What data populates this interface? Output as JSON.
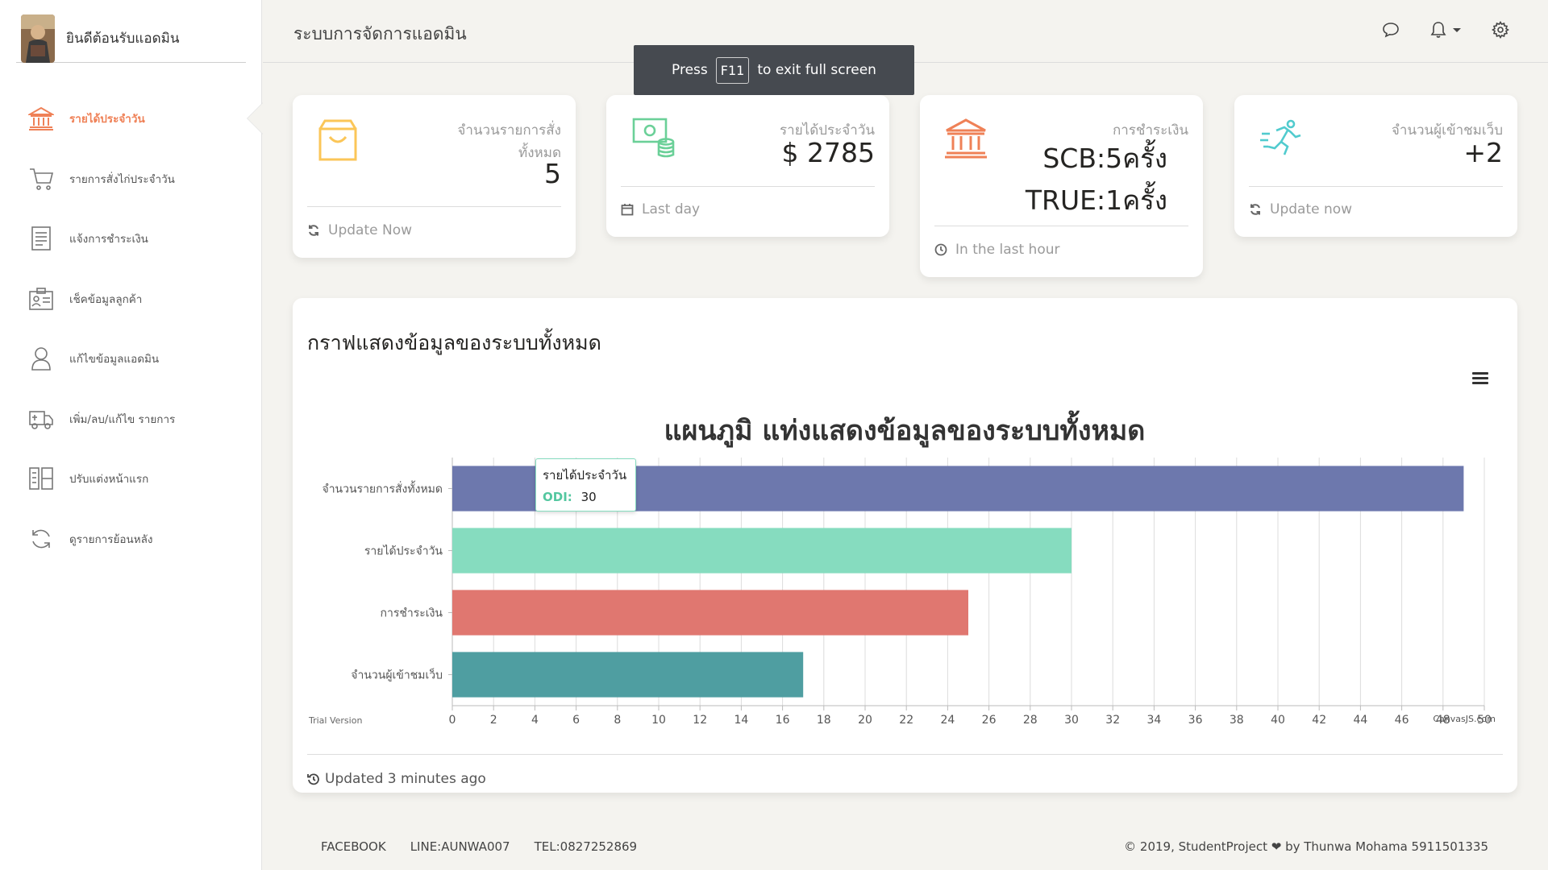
{
  "sidebar": {
    "welcome": "ยินดีต้อนรับแอดมิน",
    "items": [
      {
        "label": "รายได้ประจำวัน",
        "icon": "bank-icon",
        "active": true
      },
      {
        "label": "รายการสั่งไก่ประจำวัน",
        "icon": "cart-icon"
      },
      {
        "label": "แจ้งการชำระเงิน",
        "icon": "document-icon"
      },
      {
        "label": "เช็คข้อมูลลูกค้า",
        "icon": "id-card-icon"
      },
      {
        "label": "แก้ไขข้อมูลแอดมิน",
        "icon": "user-icon"
      },
      {
        "label": "เพิ่ม/ลบ/แก้ไข รายการ",
        "icon": "delivery-truck-icon"
      },
      {
        "label": "ปรับแต่งหน้าแรก",
        "icon": "layout-icon"
      },
      {
        "label": "ดูรายการย้อนหลัง",
        "icon": "refresh-icon"
      }
    ]
  },
  "header": {
    "title": "ระบบการจัดการแอดมิน"
  },
  "fullscreen_notice": {
    "prefix": "Press",
    "key": "F11",
    "suffix": "to exit full screen"
  },
  "cards": {
    "orders": {
      "label": "จำนวนรายการสั่งทั้งหมด",
      "value": "5",
      "footer": "Update Now",
      "color": "#fbc658"
    },
    "revenue": {
      "label": "รายได้ประจำวัน",
      "value": "$ 2785",
      "footer": "Last day",
      "color": "#6bd098"
    },
    "payment": {
      "label": "การชำระเงิน",
      "line1": "SCB:5ครั้ง",
      "line2": "TRUE:1ครั้ง",
      "footer": "In the last hour",
      "color": "#ef8157"
    },
    "visitors": {
      "label": "จำนวนผู้เข้าชมเว็บ",
      "value": "+2",
      "footer": "Update now",
      "color": "#51cbce"
    }
  },
  "chart_section": {
    "heading": "กราฟแสดงข้อมูลของระบบทั้งหมด",
    "footer": "Updated 3 minutes ago",
    "trial": "Trial Version",
    "credit": "CanvasJS.com"
  },
  "tooltip": {
    "title": "รายได้ประจำวัน",
    "series": "ODI:",
    "value": "30"
  },
  "chart_data": {
    "type": "bar",
    "orientation": "horizontal",
    "title": "แผนภูมิ แท่งแสดงข้อมูลของระบบทั้งหมด",
    "categories": [
      "จำนวนรายการสั่งทั้งหมด",
      "รายได้ประจำวัน",
      "การชำระเงิน",
      "จำนวนผู้เข้าชมเว็บ"
    ],
    "values": [
      49,
      30,
      25,
      17
    ],
    "colors": [
      "#6d78ad",
      "#86dcbf",
      "#e07770",
      "#4f9ea1"
    ],
    "xlim": [
      0,
      50
    ],
    "ticks": [
      0,
      2,
      4,
      6,
      8,
      10,
      12,
      14,
      16,
      18,
      20,
      22,
      24,
      26,
      28,
      30,
      32,
      34,
      36,
      38,
      40,
      42,
      44,
      46,
      48,
      50
    ],
    "grid": true
  },
  "footer": {
    "links": [
      "FACEBOOK",
      "LINE:AUNWA007",
      "TEL:0827252869"
    ],
    "copyright": "© 2019, StudentProject ❤ by Thunwa Mohama 5911501335"
  }
}
